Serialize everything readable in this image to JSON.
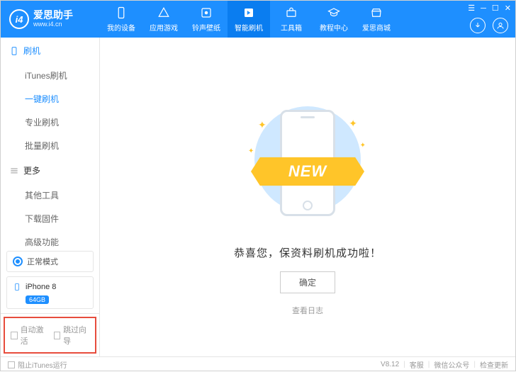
{
  "app": {
    "name": "爱思助手",
    "url": "www.i4.cn"
  },
  "nav": [
    {
      "label": "我的设备"
    },
    {
      "label": "应用游戏"
    },
    {
      "label": "铃声壁纸"
    },
    {
      "label": "智能刷机"
    },
    {
      "label": "工具箱"
    },
    {
      "label": "教程中心"
    },
    {
      "label": "爱思商城"
    }
  ],
  "sidebar": {
    "group1": {
      "title": "刷机",
      "items": [
        "iTunes刷机",
        "一键刷机",
        "专业刷机",
        "批量刷机"
      ]
    },
    "group2": {
      "title": "更多",
      "items": [
        "其他工具",
        "下载固件",
        "高级功能"
      ]
    },
    "status": "正常模式",
    "device": {
      "name": "iPhone 8",
      "storage": "64GB"
    },
    "opts": {
      "a": "自动激活",
      "b": "跳过向导"
    }
  },
  "main": {
    "ribbon": "NEW",
    "message": "恭喜您，保资料刷机成功啦！",
    "ok": "确定",
    "log": "查看日志"
  },
  "footer": {
    "block": "阻止iTunes运行",
    "version": "V8.12",
    "links": [
      "客服",
      "微信公众号",
      "检查更新"
    ]
  }
}
